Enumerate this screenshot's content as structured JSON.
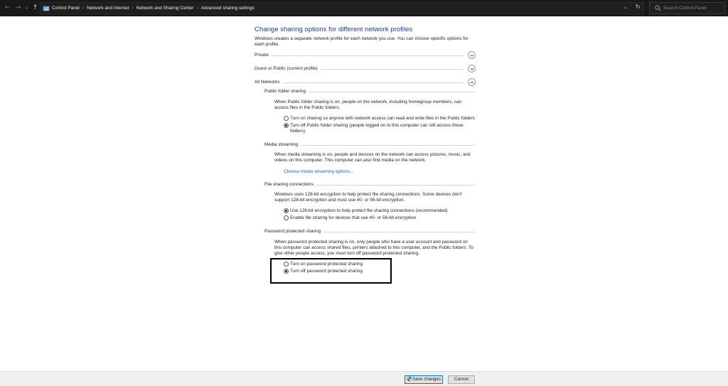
{
  "nav": {
    "back_glyph": "←",
    "forward_glyph": "→",
    "recent_glyph": "⌄",
    "up_glyph": "↑",
    "refresh_glyph": "↻",
    "dropdown_glyph": "⌄"
  },
  "breadcrumbs": [
    "Control Panel",
    "Network and Internet",
    "Network and Sharing Center",
    "Advanced sharing settings"
  ],
  "breadcrumb_separator": "›",
  "search": {
    "placeholder": "Search Control Panel"
  },
  "page": {
    "title": "Change sharing options for different network profiles",
    "intro": "Windows creates a separate network profile for each network you use. You can choose specific options for each profile."
  },
  "profiles": {
    "private": "Private",
    "guest_public": "Guest or Public (current profile)",
    "all_networks": "All Networks"
  },
  "public_folder": {
    "heading": "Public folder sharing",
    "desc": "When Public folder sharing is on, people on the network, including homegroup members, can access files in the Public folders.",
    "opt_on": "Turn on sharing so anyone with network access can read and write files in the Public folders",
    "opt_off": "Turn off Public folder sharing (people logged on to this computer can still access these folders)"
  },
  "media": {
    "heading": "Media streaming",
    "desc": "When media streaming is on, people and devices on the network can access pictures, music, and videos on this computer. This computer can also find media on the network.",
    "link": "Choose media streaming options..."
  },
  "file_sharing": {
    "heading": "File sharing connections",
    "desc": "Windows uses 128-bit encryption to help protect file sharing connections. Some devices don't support 128-bit encryption and must use 40- or 56-bit encryption.",
    "opt_128": "Use 128-bit encryption to help protect file sharing connections (recommended)",
    "opt_40": "Enable file sharing for devices that use 40- or 56-bit encryption"
  },
  "password": {
    "heading": "Password protected sharing",
    "desc": "When password protected sharing is on, only people who have a user account and password on this computer can access shared files, printers attached to this computer, and the Public folders. To give other people access, you must turn off password protected sharing.",
    "opt_on": "Turn on password protected sharing",
    "opt_off": "Turn off password protected sharing"
  },
  "footer": {
    "save": "Save changes",
    "cancel": "Cancel"
  },
  "colors": {
    "title_blue": "#1e3a9c",
    "link_blue": "#1565c0",
    "topbar_bg": "#191919"
  },
  "icons": [
    "control-panel-icon",
    "search-icon",
    "chevron-down-icon",
    "chevron-up-icon",
    "uac-shield-icon"
  ]
}
